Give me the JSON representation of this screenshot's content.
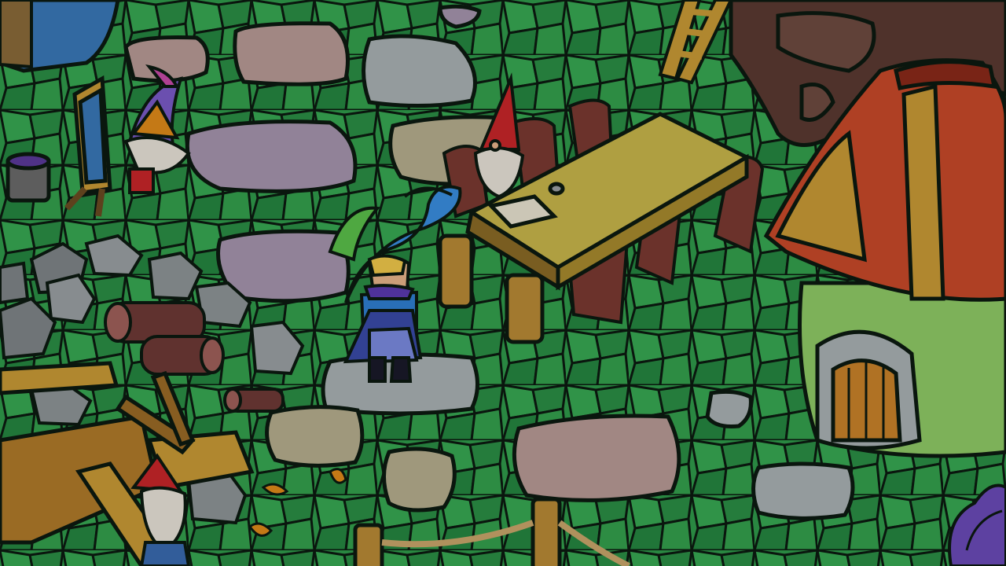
{
  "game": {
    "scene": "gnome-village-courtyard",
    "art_style": "stained-glass",
    "hud_visible": false,
    "colors": {
      "grass": "#2f9a4a",
      "grass_dark": "#1f7a39",
      "lead": "#0c1a10",
      "stone_gray": "#a9b1b3",
      "stone_lilac": "#a695ad",
      "stone_pink": "#b89a96",
      "stone_tan": "#b5ad8e",
      "wood": "#c99a36",
      "table": "#c8b64b",
      "chair": "#7a3a32",
      "hero_blue": "#2f7fd1",
      "hero_hat": "#3a8ee0",
      "gnome_red": "#c8262a",
      "mushroom_roof": "#c8492a",
      "mushroom_wall": "#8fca66"
    }
  }
}
